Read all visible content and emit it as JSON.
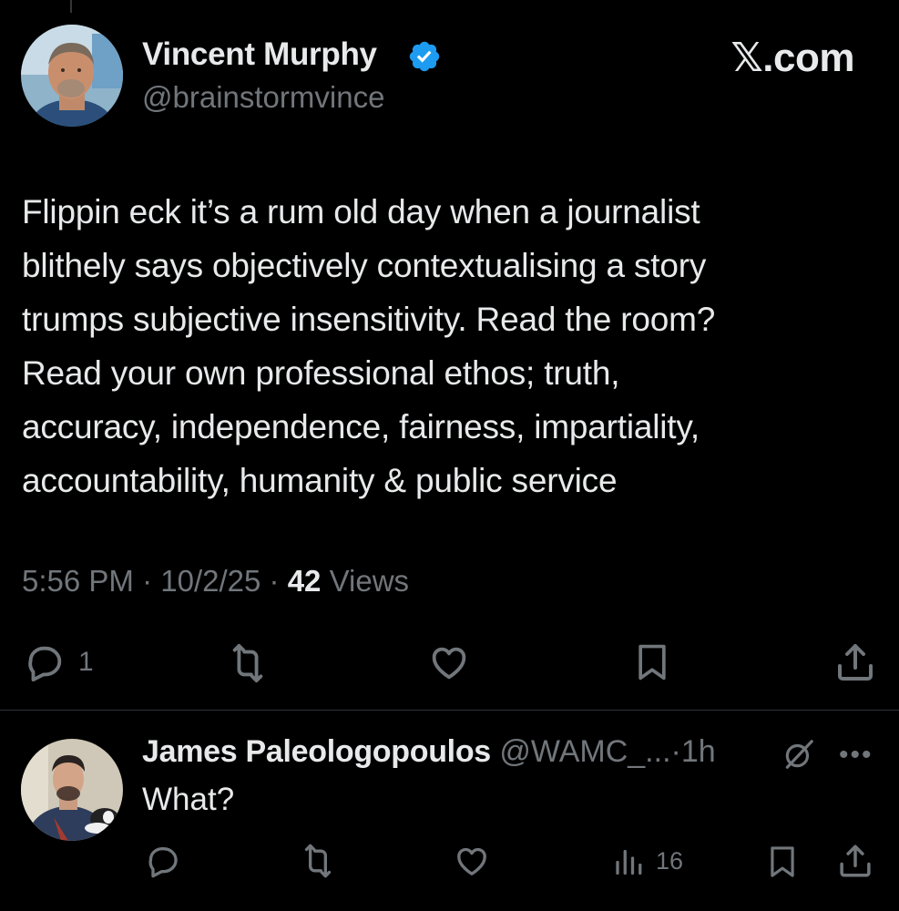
{
  "brand": "𝕏.com",
  "tweet": {
    "author_name": "Vincent Murphy",
    "author_handle": "@brainstormvince",
    "text": "Flippin eck it’s a rum old day when a journalist\nblithely says  objectively contextualising a story\ntrumps subjective insensitivity. Read the room?\nRead your own professional  ethos; truth,\naccuracy, independence, fairness, impartiality,\naccountability, humanity & public service",
    "time": "5:56 PM",
    "date": "10/2/25",
    "views_count": "42",
    "views_label": "Views",
    "separator": "·",
    "reply_count": "1"
  },
  "reply": {
    "author_name": "James Paleologopoulos",
    "author_handle": "@WAMC_...",
    "separator": "·",
    "time": "1h",
    "text": "What?",
    "views_count": "16",
    "more": "•••"
  },
  "colors": {
    "background": "#000000",
    "text": "#e7e9ea",
    "secondary": "#71767b",
    "verified": "#1d9bf0",
    "divider": "#2f3336"
  },
  "icons": [
    "verified-badge-icon",
    "reply-icon",
    "retweet-icon",
    "like-icon",
    "bookmark-icon",
    "share-icon",
    "grok-icon",
    "views-icon",
    "more-icon"
  ]
}
